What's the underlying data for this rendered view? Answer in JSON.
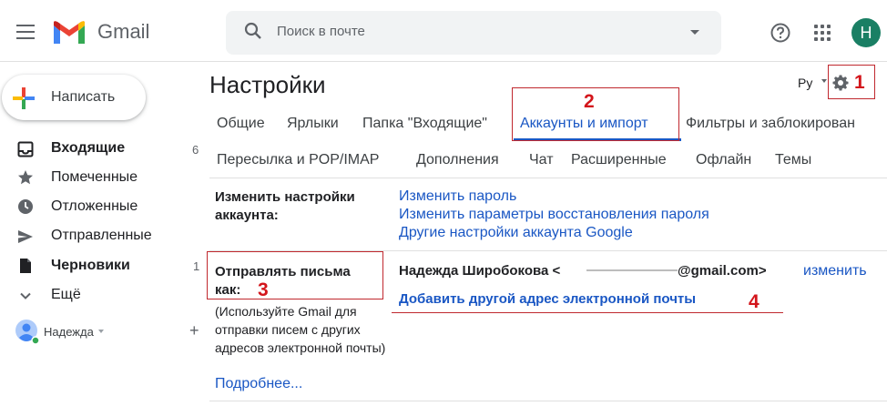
{
  "topbar": {
    "logo_text": "Gmail",
    "search_placeholder": "Поиск в почте",
    "avatar_letter": "Н"
  },
  "sidebar": {
    "compose_label": "Написать",
    "items": [
      {
        "label": "Входящие",
        "icon": "inbox-icon",
        "count": "6"
      },
      {
        "label": "Помеченные",
        "icon": "star-icon",
        "count": ""
      },
      {
        "label": "Отложенные",
        "icon": "clock-icon",
        "count": ""
      },
      {
        "label": "Отправленные",
        "icon": "send-icon",
        "count": ""
      },
      {
        "label": "Черновики",
        "icon": "draft-icon",
        "count": "1"
      },
      {
        "label": "Ещё",
        "icon": "chevron-down-icon",
        "count": ""
      }
    ],
    "user_name": "Надежда",
    "add_label": "+"
  },
  "settings": {
    "title": "Настройки",
    "language": "Ру",
    "tabs_row1": [
      "Общие",
      "Ярлыки",
      "Папка \"Входящие\"",
      "Аккаунты и импорт",
      "Фильтры и заблокирован"
    ],
    "tabs_row2": [
      "Пересылка и POP/IMAP",
      "Дополнения",
      "Чат",
      "Расширенные",
      "Офлайн",
      "Темы"
    ],
    "active_tab": "Аккаунты и импорт",
    "change_account": {
      "label": "Изменить настройки аккаунта:",
      "links": [
        "Изменить пароль",
        "Изменить параметры восстановления пароля",
        "Другие настройки аккаунта Google"
      ]
    },
    "send_as": {
      "label": "Отправлять письма как:",
      "help": "(Используйте Gmail для отправки писем с других адресов электронной почты)",
      "more_link": "Подробнее...",
      "name": "Надежда Широбокова <",
      "email_suffix": "@gmail.com>",
      "edit_link": "изменить",
      "add_address_link": "Добавить другой адрес электронной почты"
    }
  },
  "annotations": {
    "marker_1": "1",
    "marker_2": "2",
    "marker_3": "3",
    "marker_4": "4",
    "color": "#d3151b"
  },
  "colors": {
    "link": "#1a57c4",
    "avatar": "#1a7f64",
    "annotation": "#d3151b"
  }
}
